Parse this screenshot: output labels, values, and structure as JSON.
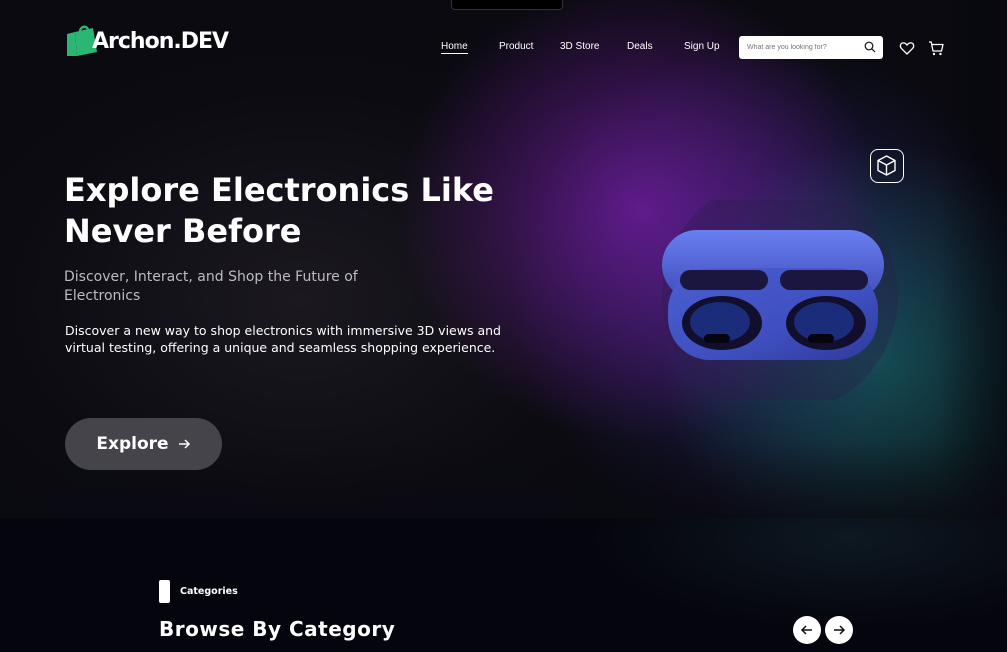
{
  "brand": {
    "name": "Archon.DEV",
    "logo_color": "#2bb673"
  },
  "nav": {
    "items": [
      {
        "label": "Home",
        "active": true
      },
      {
        "label": "Product"
      },
      {
        "label": "3D Store"
      },
      {
        "label": "Deals"
      },
      {
        "label": "Sign Up"
      }
    ]
  },
  "search": {
    "placeholder": "What are you looking for?",
    "icon": "search-icon"
  },
  "header_icons": [
    "heart-icon",
    "cart-icon"
  ],
  "hero": {
    "title": "Explore Electronics Like Never Before",
    "subtitle": "Discover, Interact, and Shop the Future of Electronics",
    "description": "Discover a new way to shop electronics with immersive 3D views and virtual testing, offering a unique and seamless shopping experience.",
    "cta_label": "Explore",
    "cta_icon": "arrow-right-icon",
    "badge_icon": "3d-cube-icon",
    "product": "wireless earbuds case"
  },
  "categories": {
    "eyebrow": "Categories",
    "heading": "Browse By Category",
    "controls": [
      "arrow-left-icon",
      "arrow-right-icon"
    ]
  },
  "colors": {
    "accent_purple": "#7a2ab0",
    "accent_teal": "#178a7c",
    "button_bg": "#45444b",
    "page_bg": "#05050d"
  }
}
